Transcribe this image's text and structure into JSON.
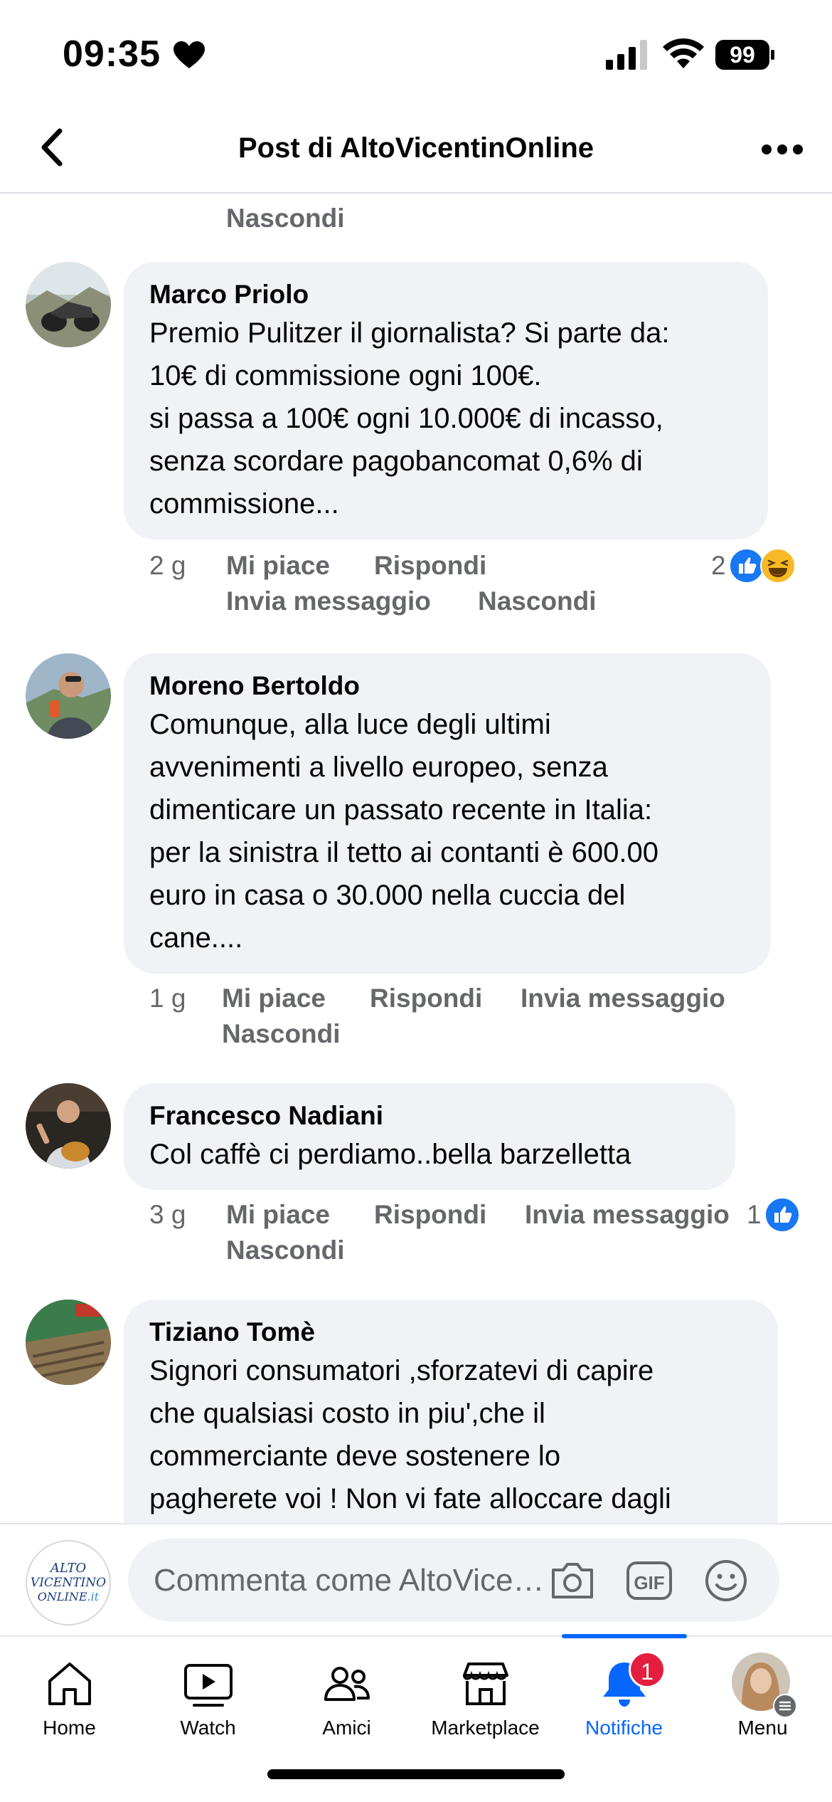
{
  "status": {
    "time": "09:35",
    "battery": "99"
  },
  "header": {
    "title": "Post di AltoVicentinOnline"
  },
  "top_fragment": {
    "hide_label": "Nascondi"
  },
  "comments": [
    {
      "author": "Marco Priolo",
      "text": "Premio Pulitzer il giornalista? Si parte da:\n10€ di commissione ogni 100€.\nsi passa a 100€ ogni 10.000€ di incasso,\nsenza scordare pagobancomat 0,6% di\ncommissione...",
      "time": "2 g",
      "like": "Mi piace",
      "reply": "Rispondi",
      "message": "Invia messaggio",
      "hide": "Nascondi",
      "reaction_count": "2",
      "reaction_icons": [
        "like-icon",
        "haha-icon"
      ]
    },
    {
      "author": "Moreno Bertoldo",
      "text": "Comunque, alla luce degli ultimi\navvenimenti a livello europeo, senza\ndimenticare un passato recente in Italia:\nper la sinistra il tetto ai contanti è 600.00\neuro in casa o 30.000 nella cuccia del\ncane....",
      "time": "1 g",
      "like": "Mi piace",
      "reply": "Rispondi",
      "message": "Invia messaggio",
      "hide": "Nascondi"
    },
    {
      "author": "Francesco Nadiani",
      "text": "Col caffè ci perdiamo..bella barzelletta",
      "time": "3 g",
      "like": "Mi piace",
      "reply": "Rispondi",
      "message": "Invia messaggio",
      "hide": "Nascondi",
      "reaction_count": "1",
      "reaction_icons": [
        "like-icon"
      ]
    },
    {
      "author": "Tiziano Tomè",
      "text": "Signori consumatori ,sforzatevi di capire\nche qualsiasi costo in piu',che il\ncommerciante deve sostenere lo\npagherete voi ! Non vi fate alloccare dagli"
    }
  ],
  "composer": {
    "placeholder": "Commenta come AltoVicentinOnline",
    "page_logo_line1": "ALTO",
    "page_logo_line2": "VICENTINO",
    "page_logo_line3": "ONLINE",
    "page_logo_tld": ".it",
    "icons": [
      "camera-icon",
      "gif-icon",
      "emoji-icon"
    ]
  },
  "tabs": [
    {
      "label": "Home",
      "icon": "home-icon"
    },
    {
      "label": "Watch",
      "icon": "watch-icon"
    },
    {
      "label": "Amici",
      "icon": "friends-icon"
    },
    {
      "label": "Marketplace",
      "icon": "marketplace-icon"
    },
    {
      "label": "Notifiche",
      "icon": "bell-icon",
      "active": true,
      "badge": "1"
    },
    {
      "label": "Menu",
      "icon": "profile-avatar"
    }
  ],
  "colors": {
    "accent": "#0866ff",
    "badge": "#e41e3f",
    "bubble": "#f0f2f5",
    "secondary_text": "#65676b"
  }
}
